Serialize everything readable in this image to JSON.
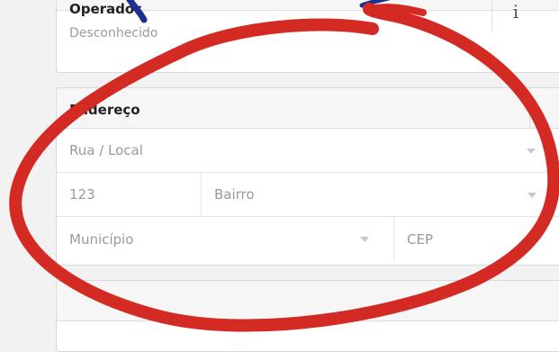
{
  "operator": {
    "title": "Operador",
    "info_icon": "i",
    "value": "Desconhecido"
  },
  "address": {
    "title": "Endereço",
    "street_placeholder": "Rua / Local",
    "number_placeholder": "123",
    "district_placeholder": "Bairro",
    "city_placeholder": "Município",
    "zip_placeholder": "CEP"
  },
  "annotation": {
    "color": "#d42a24",
    "icon": "hand-drawn-circle"
  }
}
